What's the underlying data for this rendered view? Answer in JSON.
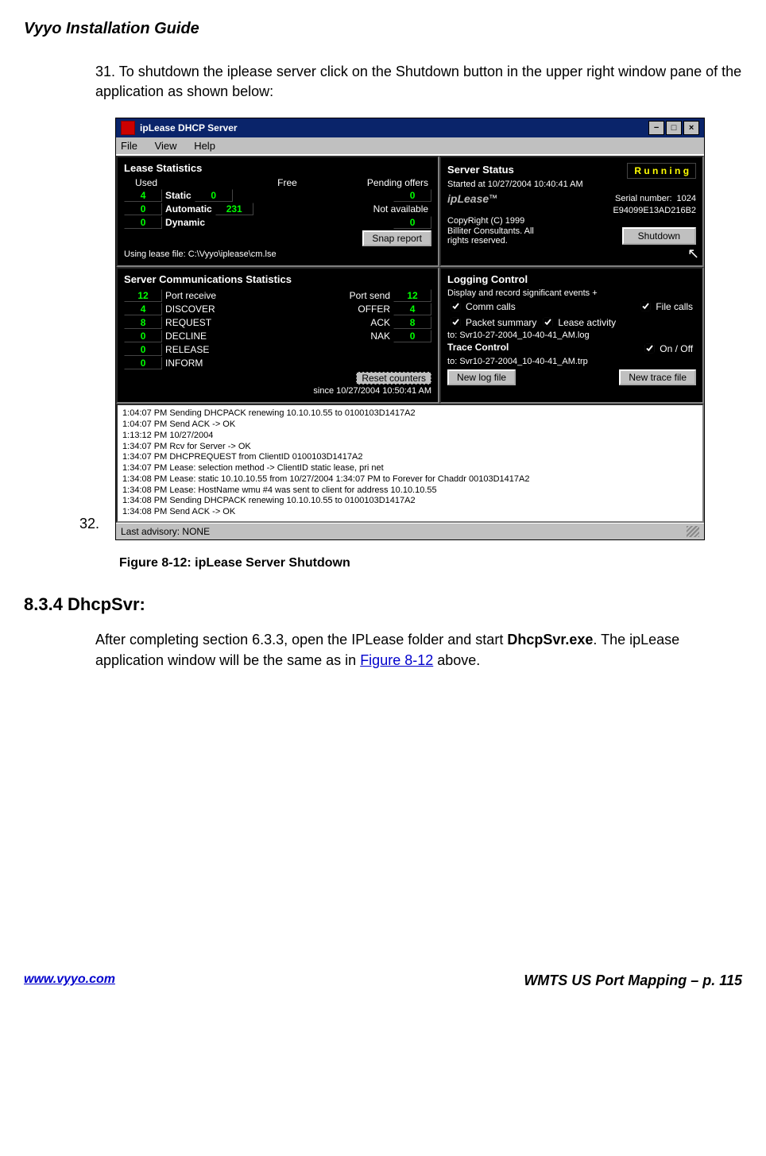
{
  "doc": {
    "title": "Vyyo Installation Guide",
    "step31": "31. To shutdown the iplease server click on the Shutdown button in the upper right window pane of the application as shown below:",
    "lead32": "32.",
    "figcap": "Figure 8-12:  ipLease Server Shutdown",
    "sec": "8.3.4 DhcpSvr:",
    "para_a": "After completing section 6.3.3, open the IPLease folder and start ",
    "para_b": "DhcpSvr.exe",
    "para_c": ".  The ipLease application window will be the same as in ",
    "para_link": "Figure 8-12",
    "para_d": " above.",
    "footer_left": "www.vyyo.com",
    "footer_right": "WMTS US Port Mapping – p. 115"
  },
  "win": {
    "title": "ipLease DHCP Server",
    "menu": {
      "file": "File",
      "view": "View",
      "help": "Help"
    },
    "tl": {
      "hd": "Lease Statistics",
      "used_lbl": "Used",
      "free_lbl": "Free",
      "static": "Static",
      "static_u": "4",
      "static_f": "0",
      "auto": "Automatic",
      "auto_u": "0",
      "auto_f": "231",
      "dyn": "Dynamic",
      "dyn_u": "0",
      "pending_lbl": "Pending offers",
      "pending": "0",
      "na_lbl": "Not available",
      "na": "0",
      "snap": "Snap report",
      "lease_file": "Using lease file: C:\\Vyyo\\iplease\\cm.lse"
    },
    "tr": {
      "hd": "Server Status",
      "running": "R u n n i n g",
      "started": "Started at 10/27/2004 10:40:41 AM",
      "logo": "ipLease",
      "tm": "™",
      "serial_lbl": "Serial number:",
      "serial": "E94099E13AD216B2",
      "port": "1024",
      "copy1": "CopyRight (C) 1999",
      "copy2": "Billiter Consultants. All",
      "copy3": "rights reserved.",
      "shutdown": "Shutdown"
    },
    "bl": {
      "hd": "Server Communications Statistics",
      "rows_left": [
        {
          "v": "12",
          "n": "Port receive"
        },
        {
          "v": "4",
          "n": "DISCOVER"
        },
        {
          "v": "8",
          "n": "REQUEST"
        },
        {
          "v": "0",
          "n": "DECLINE"
        },
        {
          "v": "0",
          "n": "RELEASE"
        },
        {
          "v": "0",
          "n": "INFORM"
        }
      ],
      "rows_right": [
        {
          "n": "Port send",
          "v": "12"
        },
        {
          "n": "OFFER",
          "v": "4"
        },
        {
          "n": "ACK",
          "v": "8"
        },
        {
          "n": "NAK",
          "v": "0"
        }
      ],
      "reset": "Reset counters",
      "since": "since 10/27/2004 10:50:41 AM"
    },
    "br": {
      "hd": "Logging Control",
      "desc": "Display and record significant events +",
      "comm": "Comm calls",
      "file": "File calls",
      "pkt": "Packet summary",
      "lease": "Lease activity",
      "logto": "to: Svr10-27-2004_10-40-41_AM.log",
      "trace_hd": "Trace Control",
      "onoff": "On / Off",
      "trpto": "to: Svr10-27-2004_10-40-41_AM.trp",
      "newlog": "New log file",
      "newtrace": "New trace file"
    },
    "log": [
      "1:04:07 PM Sending DHCPACK renewing 10.10.10.55 to 0100103D1417A2",
      "1:04:07 PM Send ACK -> OK",
      "1:13:12 PM 10/27/2004",
      "1:34:07 PM Rcv for Server -> OK",
      "1:34:07 PM DHCPREQUEST from ClientID 0100103D1417A2",
      "1:34:07 PM Lease: selection method -> ClientID static lease, pri net",
      "1:34:08 PM Lease: static 10.10.10.55 from 10/27/2004 1:34:07 PM to Forever for Chaddr 00103D1417A2",
      "1:34:08 PM Lease: HostName wmu #4 was sent to client for address 10.10.10.55",
      "1:34:08 PM Sending DHCPACK renewing 10.10.10.55 to 0100103D1417A2",
      "1:34:08 PM Send ACK -> OK"
    ],
    "status": "Last advisory: NONE"
  }
}
